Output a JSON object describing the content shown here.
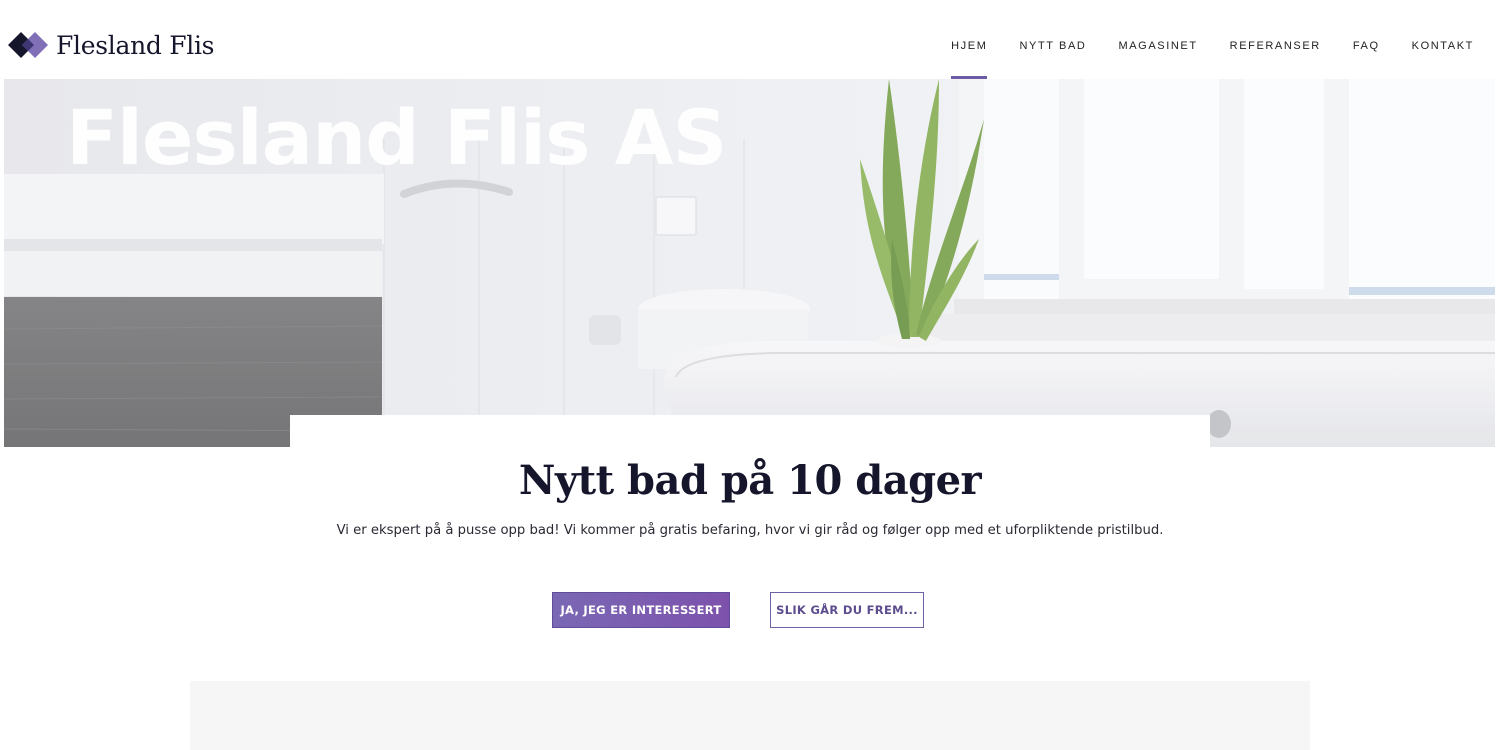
{
  "brand": {
    "name": "Flesland Flis",
    "colors": {
      "navy": "#15162b",
      "purple": "#7a68b4"
    }
  },
  "nav": {
    "items": [
      {
        "label": "HJEM",
        "active": true
      },
      {
        "label": "NYTT BAD",
        "active": false
      },
      {
        "label": "MAGASINET",
        "active": false
      },
      {
        "label": "REFERANSER",
        "active": false
      },
      {
        "label": "FAQ",
        "active": false
      },
      {
        "label": "KONTAKT",
        "active": false
      }
    ]
  },
  "hero": {
    "title": "Flesland Flis AS"
  },
  "intro": {
    "headline": "Nytt bad på 10 dager",
    "lede": "Vi er ekspert på å pusse opp bad! Vi kommer på gratis befaring, hvor vi gir råd og følger opp med et uforpliktende pristilbud.",
    "primary_button": "JA, JEG ER INTERESSERT",
    "secondary_button": "SLIK GÅR DU FREM..."
  }
}
